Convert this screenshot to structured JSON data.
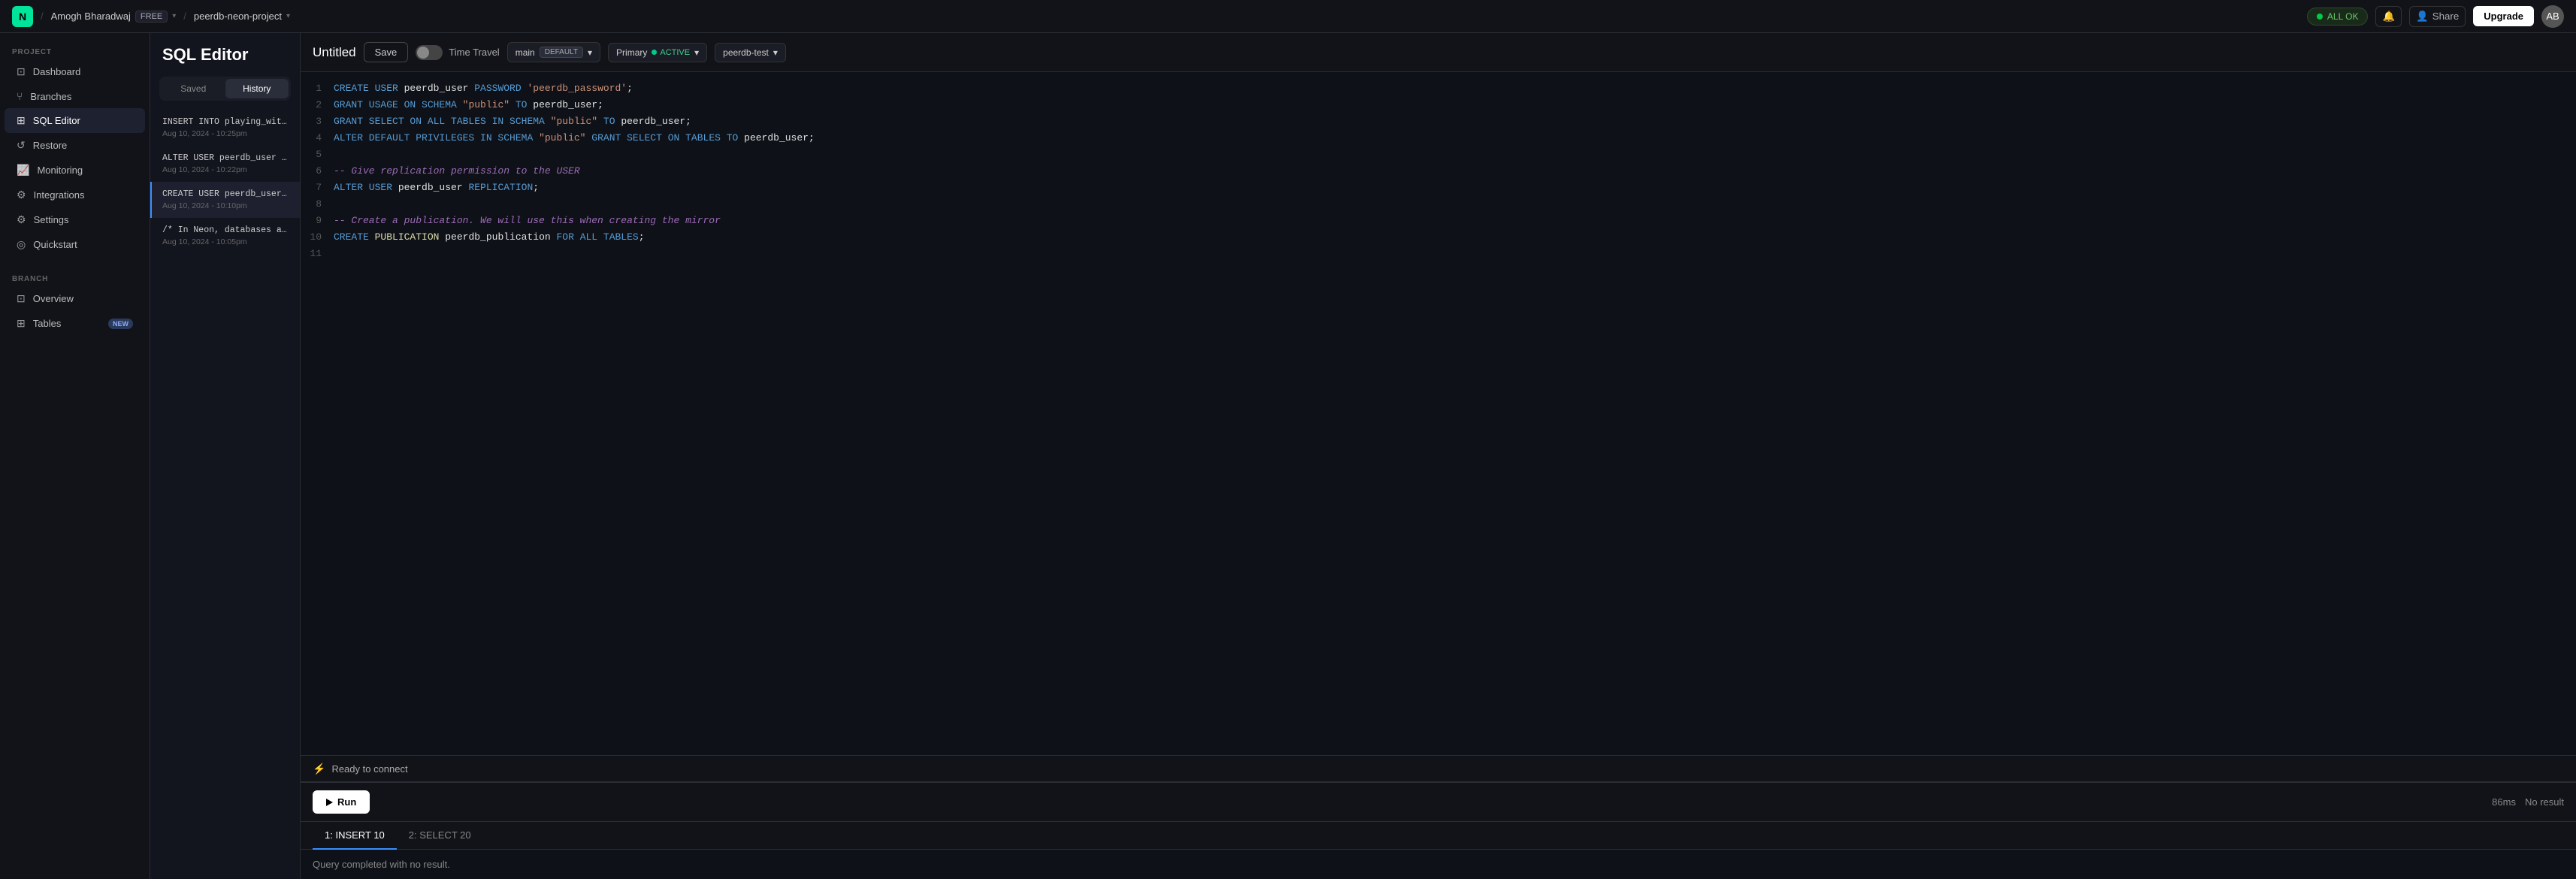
{
  "topbar": {
    "logo_text": "N",
    "user_name": "Amogh Bharadwaj",
    "user_badge": "FREE",
    "separator": "/",
    "project_name": "peerdb-neon-project",
    "status_text": "ALL OK",
    "share_label": "Share",
    "upgrade_label": "Upgrade",
    "avatar_text": "AB"
  },
  "sidebar": {
    "project_label": "PROJECT",
    "items": [
      {
        "id": "dashboard",
        "label": "Dashboard",
        "icon": "⊡"
      },
      {
        "id": "branches",
        "label": "Branches",
        "icon": "⑂"
      },
      {
        "id": "sql-editor",
        "label": "SQL Editor",
        "icon": "⊞"
      },
      {
        "id": "restore",
        "label": "Restore",
        "icon": "↺"
      },
      {
        "id": "monitoring",
        "label": "Monitoring",
        "icon": "📈"
      },
      {
        "id": "integrations",
        "label": "Integrations",
        "icon": "⚙"
      },
      {
        "id": "settings",
        "label": "Settings",
        "icon": "⚙"
      },
      {
        "id": "quickstart",
        "label": "Quickstart",
        "icon": "◎"
      }
    ],
    "branch_label": "BRANCH",
    "branch_items": [
      {
        "id": "overview",
        "label": "Overview",
        "icon": "⊡"
      },
      {
        "id": "tables",
        "label": "Tables",
        "icon": "⊞",
        "badge": "NEW"
      }
    ]
  },
  "history_panel": {
    "title": "SQL Editor",
    "tab_saved": "Saved",
    "tab_history": "History",
    "active_tab": "history",
    "items": [
      {
        "id": "h1",
        "title": "INSERT INTO playing_wit...",
        "date": "Aug 10, 2024 - 10:25pm",
        "active": false
      },
      {
        "id": "h2",
        "title": "ALTER USER peerdb_user ...",
        "date": "Aug 10, 2024 - 10:22pm",
        "active": false
      },
      {
        "id": "h3",
        "title": "CREATE USER peerdb_user...",
        "date": "Aug 10, 2024 - 10:10pm",
        "active": true
      },
      {
        "id": "h4",
        "title": "/* In Neon, databases a...",
        "date": "Aug 10, 2024 - 10:05pm",
        "active": false
      }
    ]
  },
  "editor": {
    "title": "Untitled",
    "save_label": "Save",
    "time_travel_label": "Time Travel",
    "branch_name": "main",
    "branch_badge": "DEFAULT",
    "primary_label": "Primary",
    "active_badge": "ACTIVE",
    "peer_name": "peerdb-test",
    "status_text": "Ready to connect",
    "run_label": "Run",
    "timing": "86ms",
    "result_text": "No result",
    "tabs": [
      {
        "id": "insert",
        "label": "1: INSERT 10",
        "active": true
      },
      {
        "id": "select",
        "label": "2: SELECT 20",
        "active": false
      }
    ],
    "query_result_text": "Query completed with no result.",
    "lines": [
      {
        "num": 1,
        "code": "CREATE USER peerdb_user PASSWORD 'peerdb_password';"
      },
      {
        "num": 2,
        "code": "GRANT USAGE ON SCHEMA \"public\" TO peerdb_user;"
      },
      {
        "num": 3,
        "code": "GRANT SELECT ON ALL TABLES IN SCHEMA \"public\" TO peerdb_user;"
      },
      {
        "num": 4,
        "code": "ALTER DEFAULT PRIVILEGES IN SCHEMA \"public\" GRANT SELECT ON TABLES TO peerdb_user;"
      },
      {
        "num": 5,
        "code": ""
      },
      {
        "num": 6,
        "code": "-- Give replication permission to the USER"
      },
      {
        "num": 7,
        "code": "ALTER USER peerdb_user REPLICATION;"
      },
      {
        "num": 8,
        "code": ""
      },
      {
        "num": 9,
        "code": "-- Create a publication. We will use this when creating the mirror"
      },
      {
        "num": 10,
        "code": "CREATE PUBLICATION peerdb_publication FOR ALL TABLES;"
      },
      {
        "num": 11,
        "code": ""
      }
    ]
  }
}
